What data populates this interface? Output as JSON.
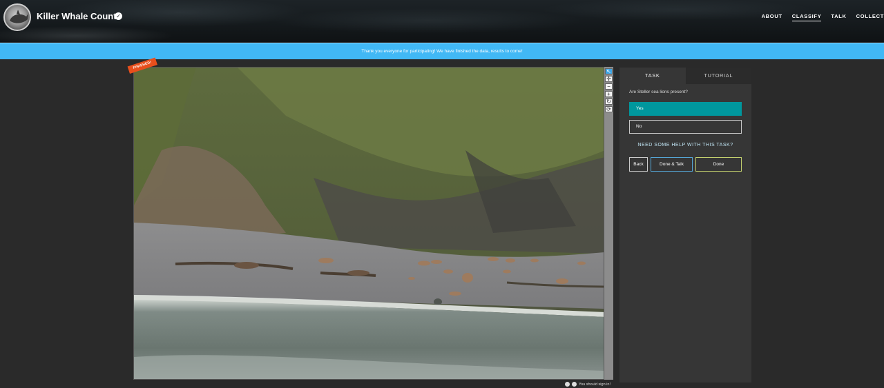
{
  "header": {
    "title": "Killer Whale Count",
    "verified_icon": "checkmark-circle-icon",
    "nav": [
      "ABOUT",
      "CLASSIFY",
      "TALK",
      "COLLECT"
    ],
    "active_nav": "CLASSIFY"
  },
  "banner": {
    "text": "Thank you everyone for participating! We have finished the data, results to come!",
    "color": "#41b8f5"
  },
  "viewer": {
    "badge": "FINISHED!",
    "tools": [
      "pointer-icon",
      "move-icon",
      "zoom-out-icon",
      "zoom-in-icon",
      "rotate-icon",
      "reset-icon"
    ],
    "footer_text": "You should sign in!"
  },
  "task": {
    "tabs": [
      "TASK",
      "TUTORIAL"
    ],
    "question": "Are Steller sea lions present?",
    "answers": [
      "Yes",
      "No"
    ],
    "selected": "Yes",
    "help": "NEED SOME HELP WITH THIS TASK?",
    "buttons": {
      "back": "Back",
      "done_talk": "Done & Talk",
      "done": "Done"
    },
    "colors": {
      "selected": "#00979d",
      "talk": "#55a6d6",
      "done": "#c3d16e"
    }
  }
}
